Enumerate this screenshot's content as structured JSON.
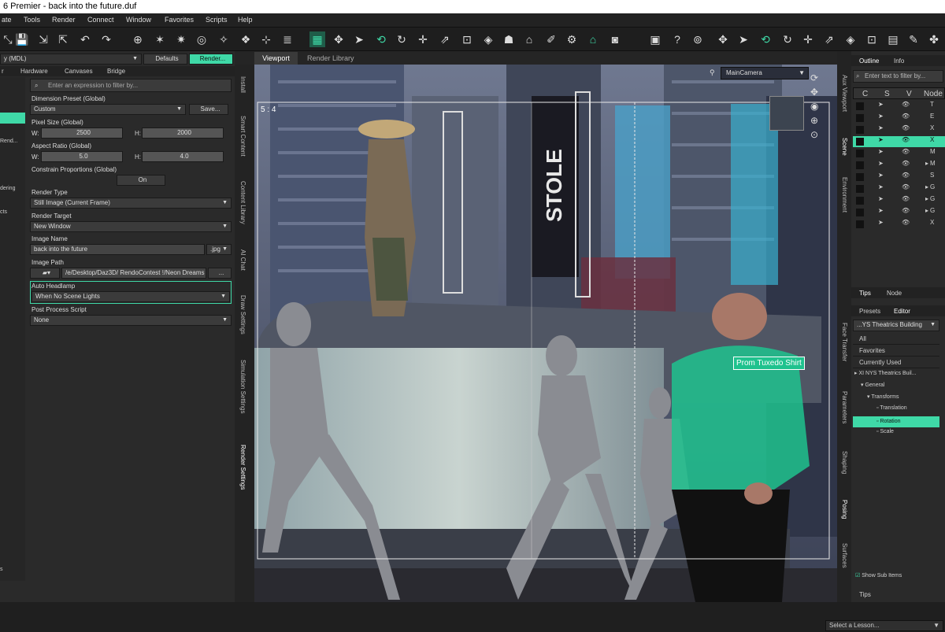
{
  "window": {
    "title": "6 Premier - back into the future.duf"
  },
  "menu": [
    "ate",
    "Tools",
    "Render",
    "Connect",
    "Window",
    "Favorites",
    "Scripts",
    "Help"
  ],
  "left": {
    "preset_dropdown": "y (MDL)",
    "defaults_btn": "Defaults",
    "render_btn": "Render...",
    "tabs": [
      "r",
      "Hardware",
      "Canvases",
      "Bridge"
    ],
    "filter_placeholder": "Enter an expression to filter by...",
    "side_items": [
      "",
      "",
      "Rend...",
      "",
      "",
      "",
      "dering",
      "s",
      "cts",
      "",
      ""
    ],
    "dimension_label": "Dimension Preset (Global)",
    "dimension_value": "Custom",
    "save_btn": "Save...",
    "pixel_label": "Pixel Size (Global)",
    "w_label": "W:",
    "w_value": "2500",
    "h_label": "H:",
    "h_value": "2000",
    "aspect_label": "Aspect Ratio (Global)",
    "aw_value": "5.0",
    "ah_value": "4.0",
    "constrain_label": "Constrain Proportions (Global)",
    "constrain_value": "On",
    "render_type_label": "Render Type",
    "render_type_value": "Still Image (Current Frame)",
    "render_target_label": "Render Target",
    "render_target_value": "New Window",
    "image_name_label": "Image Name",
    "image_name_value": "back into the future",
    "ext_value": ".jpg",
    "image_path_label": "Image Path",
    "image_path_value": "/e/Desktop/Daz3D/ RendoContest !/Neon Dreams",
    "browse_btn": "...",
    "headlamp_label": "Auto Headlamp",
    "headlamp_value": "When No Scene Lights",
    "post_label": "Post Process Script",
    "post_value": "None",
    "bottom_item": "s"
  },
  "vside": [
    "Install",
    "Smart Content",
    "Content Library",
    "AI Chat",
    "Draw Settings",
    "Simulation Settings",
    "Render Settings"
  ],
  "viewport": {
    "tabs": [
      "Viewport",
      "Render Library"
    ],
    "camera": "MainCamera",
    "aspect": "5 : 4",
    "tooltip": "Prom Tuxedo Shirt",
    "sign_text": "STOLE"
  },
  "rside": [
    "Aux Viewport",
    "Scene",
    "Environment",
    "Face Transfer",
    "Parameters",
    "Shaping",
    "Posing",
    "Surfaces"
  ],
  "right": {
    "tabs": [
      "Outline",
      "Info"
    ],
    "filter_placeholder": "Enter text to filter by...",
    "cols": [
      "C",
      "S",
      "V",
      "Node"
    ],
    "nodes": [
      "T",
      "E",
      "X",
      "X",
      "M",
      "M",
      "S",
      "G",
      "G",
      "G",
      "X"
    ],
    "tips_tabs": [
      "Tips",
      "Node"
    ],
    "ed_tabs": [
      "Presets",
      "Editor"
    ],
    "building": "...YS Theatrics Building",
    "cats": [
      "All",
      "Favorites",
      "Currently Used"
    ],
    "tree": [
      "XI NYS Theatrics Buil...",
      "General",
      "Transforms",
      "Translation",
      "Rotation",
      "Scale"
    ],
    "show_sub": "Show Sub Items",
    "tips_bottom": "Tips"
  },
  "bottom": {
    "lesson": "Select a Lesson..."
  },
  "colors": {
    "accent": "#3fd9a7",
    "highlight": "#33e0b0"
  }
}
